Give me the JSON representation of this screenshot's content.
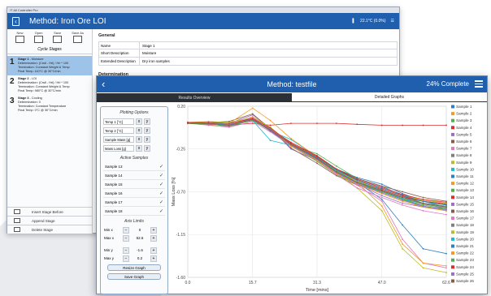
{
  "back_window": {
    "titlebar": "IT All Controller Pro",
    "title": "Method: Iron Ore LOI",
    "status_text": "22.1°C (0.0%)",
    "toolbar": [
      "New",
      "Open",
      "Save",
      "Save As"
    ],
    "cycle_stages_label": "Cycle Stages",
    "stages": [
      {
        "num": "1",
        "name": "Stage 1",
        "type": "Moisture",
        "lines": [
          "Determination: (Crstl - Hrl) / Hrl * 100",
          "Termination: Constant Weight & Temp",
          "Final Temp: 110°C @ 30°C/min"
        ]
      },
      {
        "num": "2",
        "name": "Stage 2",
        "type": "LOI",
        "lines": [
          "Determination: (Crstl - Hrl) / Hrl * 100",
          "Termination: Constant Weight & Temp",
          "Final Temp: 980°C @ 30°C/min"
        ]
      },
      {
        "num": "3",
        "name": "Stage 3",
        "type": "Cooling",
        "lines": [
          "Determination: 0",
          "Termination: Constant Temperature",
          "Final Temp: 0°C @ 30°C/min"
        ]
      }
    ],
    "bottom_buttons": [
      "Insert Stage Before",
      "Append Stage",
      "Delete Stage"
    ],
    "general_label": "General",
    "fields": [
      {
        "key": "Name",
        "value": "Stage 1"
      },
      {
        "key": "Short Description",
        "value": "Moisture"
      },
      {
        "key": "Extended Description",
        "value": "Dry iron samples"
      }
    ],
    "determination_label": "Determination"
  },
  "front_window": {
    "title": "Method: testfile",
    "progress": "24% Complete",
    "tabs": [
      "Results Overview",
      "Detailed Graphs"
    ],
    "plotting_options_label": "Plotting Options",
    "plot_rows": [
      "Temp 1 [°C]",
      "Temp 2 [°C]",
      "Sample Mass [g]",
      "Mass Loss [g]"
    ],
    "active_samples_label": "Active Samples",
    "active_samples": [
      "Sample 13",
      "Sample 14",
      "Sample 15",
      "Sample 16",
      "Sample 17",
      "Sample 18"
    ],
    "axis_limits_label": "Axis Limits",
    "axis_limits": [
      {
        "label": "Min x",
        "value": "0"
      },
      {
        "label": "Max x",
        "value": "62.6"
      },
      {
        "label": "Min y",
        "value": "-1.6"
      },
      {
        "label": "Max y",
        "value": "0.2"
      }
    ],
    "buttons": [
      "Resize Graph",
      "Save Graph"
    ],
    "colors": {
      "header": "#1f5fae",
      "selected_stage": "#9ec3e8"
    }
  },
  "chart_data": {
    "type": "line",
    "xlabel": "Time [mins]",
    "ylabel": "Mass Loss [%]",
    "xlim": [
      0,
      62.6
    ],
    "ylim": [
      -1.6,
      0.2
    ],
    "xticks": [
      "0.0",
      "15.7",
      "31.3",
      "47.0",
      "62.6"
    ],
    "yticks": [
      "0.20",
      "-0.25",
      "-0.70",
      "-1.15",
      "-1.60"
    ],
    "x": [
      0,
      5,
      10,
      15.7,
      20,
      25,
      31.3,
      36,
      41,
      47,
      52,
      57,
      62.6
    ],
    "series": [
      {
        "name": "Sample 1",
        "color": "#2f7fc1",
        "values": [
          0.03,
          0.01,
          0.0,
          0.05,
          -0.05,
          -0.22,
          -0.35,
          -0.46,
          -0.55,
          -0.62,
          -0.72,
          -0.8,
          -0.86
        ]
      },
      {
        "name": "Sample 2",
        "color": "#f59a23",
        "values": [
          0.02,
          0.0,
          0.01,
          0.09,
          -0.02,
          -0.2,
          -0.36,
          -0.5,
          -0.6,
          -0.67,
          -0.74,
          -0.78,
          -0.82
        ]
      },
      {
        "name": "Sample 3",
        "color": "#4fb04f",
        "values": [
          0.02,
          0.02,
          -0.02,
          0.06,
          -0.04,
          -0.21,
          -0.3,
          -0.43,
          -0.56,
          -0.64,
          -0.74,
          -0.82,
          -0.88
        ]
      },
      {
        "name": "Sample 4",
        "color": "#d62f2f",
        "values": [
          0.02,
          0.03,
          0.0,
          0.02,
          0.0,
          0.02,
          0.02,
          0.02,
          0.01,
          0.0,
          0.0,
          0.0,
          0.0
        ]
      },
      {
        "name": "Sample 5",
        "color": "#9a6fc4",
        "values": [
          0.02,
          0.02,
          0.02,
          0.11,
          -0.03,
          -0.25,
          -0.37,
          -0.48,
          -0.57,
          -0.65,
          -0.73,
          -0.8,
          -0.84
        ]
      },
      {
        "name": "Sample 6",
        "color": "#8c5a44",
        "values": [
          0.02,
          0.03,
          0.04,
          0.12,
          -0.04,
          -0.24,
          -0.4,
          -0.53,
          -0.63,
          -0.7,
          -0.76,
          -0.8,
          -0.83
        ]
      },
      {
        "name": "Sample 7",
        "color": "#e377c2",
        "values": [
          0.03,
          0.0,
          -0.02,
          0.04,
          -0.07,
          -0.22,
          -0.36,
          -0.49,
          -0.63,
          -0.8,
          -1.2,
          -1.45,
          -1.5
        ]
      },
      {
        "name": "Sample 8",
        "color": "#7f7f7f",
        "values": [
          0.02,
          0.02,
          0.0,
          0.07,
          -0.05,
          -0.2,
          -0.34,
          -0.48,
          -0.6,
          -0.7,
          -0.78,
          -0.86,
          -0.9
        ]
      },
      {
        "name": "Sample 9",
        "color": "#bcbd22",
        "values": [
          0.03,
          0.04,
          0.03,
          0.08,
          -0.02,
          -0.2,
          -0.36,
          -0.5,
          -0.66,
          -0.9,
          -1.3,
          -1.5,
          -1.55
        ]
      },
      {
        "name": "Sample 10",
        "color": "#17becf",
        "values": [
          0.02,
          0.02,
          -0.01,
          0.06,
          -0.06,
          -0.15,
          -0.33,
          -0.47,
          -0.59,
          -0.69,
          -0.78,
          -0.85,
          -0.9
        ]
      },
      {
        "name": "Sample 11",
        "color": "#2f7fc1",
        "values": [
          0.02,
          0.01,
          0.01,
          0.05,
          -0.03,
          -0.2,
          -0.35,
          -0.5,
          -0.6,
          -0.78,
          -1.05,
          -1.3,
          -1.35
        ]
      },
      {
        "name": "Sample 12",
        "color": "#f59a23",
        "values": [
          0.02,
          0.03,
          0.02,
          0.18,
          0.05,
          -0.14,
          -0.33,
          -0.48,
          -0.6,
          -0.85,
          -1.25,
          -1.45,
          -1.48
        ]
      },
      {
        "name": "Sample 13",
        "color": "#4fb04f",
        "values": [
          0.02,
          0.02,
          0.0,
          0.06,
          -0.06,
          -0.22,
          -0.38,
          -0.52,
          -0.62,
          -0.7,
          -0.78,
          -0.82,
          -0.85
        ]
      },
      {
        "name": "Sample 14",
        "color": "#d62f2f",
        "values": [
          0.03,
          0.02,
          0.01,
          0.07,
          -0.04,
          -0.18,
          -0.32,
          -0.46,
          -0.58,
          -0.68,
          -0.75,
          -0.8,
          -0.83
        ]
      },
      {
        "name": "Sample 15",
        "color": "#9a6fc4",
        "values": [
          0.02,
          0.03,
          0.02,
          0.06,
          -0.06,
          -0.22,
          -0.35,
          -0.5,
          -0.62,
          -0.74,
          -0.82,
          -0.86,
          -0.88
        ]
      },
      {
        "name": "Sample 16",
        "color": "#8c5a44",
        "values": [
          0.02,
          0.01,
          0.0,
          0.05,
          -0.05,
          -0.2,
          -0.33,
          -0.46,
          -0.56,
          -0.64,
          -0.7,
          -0.76,
          -0.8
        ]
      },
      {
        "name": "Sample 17",
        "color": "#e377c2",
        "values": [
          0.02,
          0.02,
          0.01,
          0.08,
          -0.04,
          -0.2,
          -0.37,
          -0.52,
          -0.66,
          -0.76,
          -0.84,
          -0.9,
          -0.94
        ]
      },
      {
        "name": "Sample 18",
        "color": "#7f7f7f",
        "values": [
          0.03,
          0.02,
          -0.01,
          0.06,
          -0.05,
          -0.21,
          -0.36,
          -0.5,
          -0.6,
          -0.69,
          -0.77,
          -0.83,
          -0.87
        ]
      },
      {
        "name": "Sample 19",
        "color": "#bcbd22",
        "values": [
          0.02,
          0.02,
          0.02,
          0.06,
          -0.03,
          -0.19,
          -0.34,
          -0.48,
          -0.59,
          -0.67,
          -0.74,
          -0.79,
          -0.82
        ]
      },
      {
        "name": "Sample 20",
        "color": "#17becf",
        "values": [
          0.02,
          0.03,
          0.01,
          0.05,
          -0.16,
          -0.21,
          -0.35,
          -0.49,
          -0.61,
          -0.7,
          -0.77,
          -0.82,
          -0.86
        ]
      },
      {
        "name": "Sample 21",
        "color": "#2f7fc1",
        "values": [
          0.03,
          0.02,
          0.0,
          0.07,
          -0.05,
          -0.2,
          -0.34,
          -0.47,
          -0.58,
          -0.67,
          -0.74,
          -0.8,
          -0.84
        ]
      },
      {
        "name": "Sample 22",
        "color": "#f59a23",
        "values": [
          0.02,
          0.02,
          0.01,
          0.06,
          -0.04,
          -0.22,
          -0.37,
          -0.51,
          -0.62,
          -0.72,
          -0.8,
          -0.86,
          -0.9
        ]
      },
      {
        "name": "Sample 23",
        "color": "#4fb04f",
        "values": [
          0.02,
          0.01,
          0.0,
          0.05,
          -0.05,
          -0.2,
          -0.35,
          -0.48,
          -0.6,
          -0.7,
          -0.78,
          -0.84,
          -0.88
        ]
      },
      {
        "name": "Sample 24",
        "color": "#d62f2f",
        "values": [
          0.03,
          0.03,
          0.02,
          0.07,
          -0.03,
          -0.19,
          -0.33,
          -0.46,
          -0.57,
          -0.66,
          -0.73,
          -0.78,
          -0.81
        ]
      },
      {
        "name": "Sample 25",
        "color": "#9a6fc4",
        "values": [
          0.02,
          0.02,
          0.01,
          0.06,
          -0.04,
          -0.21,
          -0.36,
          -0.5,
          -0.61,
          -0.71,
          -0.79,
          -0.85,
          -0.89
        ]
      },
      {
        "name": "Sample 26",
        "color": "#8c5a44",
        "values": [
          0.02,
          0.02,
          0.0,
          0.06,
          -0.05,
          -0.2,
          -0.35,
          -0.49,
          -0.6,
          -0.69,
          -0.76,
          -0.82,
          -0.86
        ]
      }
    ]
  }
}
